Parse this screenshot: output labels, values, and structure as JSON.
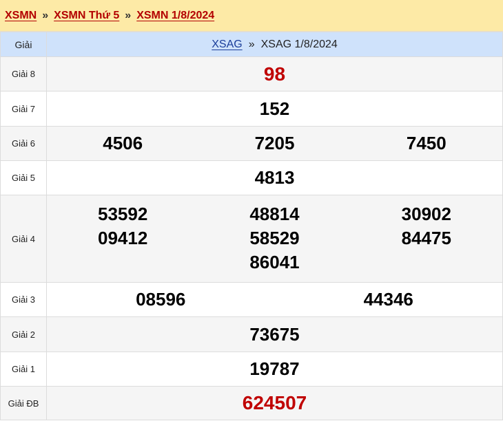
{
  "breadcrumb": {
    "items": [
      "XSMN",
      "XSMN Thứ 5",
      "XSMN 1/8/2024"
    ],
    "separator": "»"
  },
  "header": {
    "label": "Giải",
    "link": "XSAG",
    "separator": "»",
    "title": "XSAG 1/8/2024"
  },
  "prizes": {
    "g8": {
      "label": "Giải 8",
      "numbers": [
        "98"
      ]
    },
    "g7": {
      "label": "Giải 7",
      "numbers": [
        "152"
      ]
    },
    "g6": {
      "label": "Giải 6",
      "numbers": [
        "4506",
        "7205",
        "7450"
      ]
    },
    "g5": {
      "label": "Giải 5",
      "numbers": [
        "4813"
      ]
    },
    "g4": {
      "label": "Giải 4",
      "numbers": [
        "53592",
        "48814",
        "30902",
        "09412",
        "58529",
        "84475",
        "86041"
      ]
    },
    "g3": {
      "label": "Giải 3",
      "numbers": [
        "08596",
        "44346"
      ]
    },
    "g2": {
      "label": "Giải 2",
      "numbers": [
        "73675"
      ]
    },
    "g1": {
      "label": "Giải 1",
      "numbers": [
        "19787"
      ]
    },
    "gdb": {
      "label": "Giải ĐB",
      "numbers": [
        "624507"
      ]
    }
  },
  "colors": {
    "breadcrumb_bg": "#fdeaa6",
    "breadcrumb_link": "#b30000",
    "header_bg": "#cfe2fb",
    "header_link": "#1a3d9a",
    "highlight_number": "#c00000"
  }
}
